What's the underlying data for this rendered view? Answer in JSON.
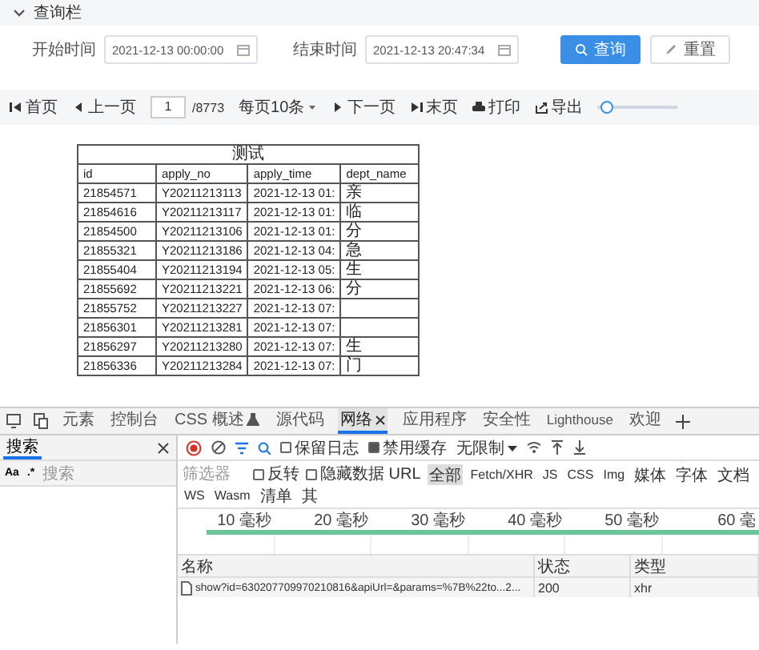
{
  "query_panel": {
    "title": "查询栏",
    "expanded": true,
    "fields": [
      {
        "label": "开始时间",
        "value": "2021-12-13 00:00:00"
      },
      {
        "label": "结束时间",
        "value": "2021-12-13 20:47:34"
      }
    ],
    "buttons": [
      {
        "label": "查询",
        "kind": "primary"
      },
      {
        "label": "重置",
        "kind": "default"
      }
    ]
  },
  "pager": {
    "first": "首页",
    "prev": "上一页",
    "page": "1",
    "total": "/8773",
    "page_size": "每页10条",
    "next": "下一页",
    "last": "末页",
    "print": "打印",
    "export": "导出",
    "zoom": {
      "level": 0.05
    }
  },
  "report": {
    "title": "测试",
    "columns": [
      "id",
      "apply_no",
      "apply_time",
      "dept_name"
    ],
    "rows": [
      [
        "21854571",
        "Y20211213113",
        "2021-12-13 01:",
        "亲"
      ],
      [
        "21854616",
        "Y20211213117",
        "2021-12-13 01:",
        "临"
      ],
      [
        "21854500",
        "Y20211213106",
        "2021-12-13 01:",
        "分"
      ],
      [
        "21855321",
        "Y20211213186",
        "2021-12-13 04:",
        "急"
      ],
      [
        "21855404",
        "Y20211213194",
        "2021-12-13 05:",
        "生"
      ],
      [
        "21855692",
        "Y20211213221",
        "2021-12-13 06:",
        "分"
      ],
      [
        "21855752",
        "Y20211213227",
        "2021-12-13 07:"
      ],
      [
        "21856301",
        "Y20211213281",
        "2021-12-13 07:"
      ],
      [
        "21856297",
        "Y20211213280",
        "2021-12-13 07:",
        "生"
      ],
      [
        "21856336",
        "Y20211213284",
        "2021-12-13 07:",
        "门"
      ]
    ]
  },
  "devtools": {
    "tabs": [
      {
        "label": "元素",
        "selected": false
      },
      {
        "label": "控制台",
        "selected": false
      },
      {
        "label": "CSS 概述",
        "selected": false,
        "experimental": true
      },
      {
        "label": "源代码",
        "selected": false
      },
      {
        "label": "网络",
        "selected": true,
        "closable": true
      },
      {
        "label": "应用程序",
        "selected": false
      },
      {
        "label": "安全性",
        "selected": false
      },
      {
        "label": "Lighthouse",
        "selected": false
      },
      {
        "label": "欢迎",
        "selected": false
      }
    ],
    "search_panel": {
      "tab": "搜索",
      "case": "Aa",
      "regex": ".*",
      "placeholder": "搜索"
    },
    "toolbar": {
      "recording": true,
      "preserve_log": {
        "label": "保留日志",
        "checked": false
      },
      "disable_cache": {
        "label": "禁用缓存",
        "checked": true
      },
      "throttle": "无限制"
    },
    "filter": {
      "placeholder": "筛选器",
      "invert": {
        "label": "反转",
        "checked": false
      },
      "hide_data_urls": {
        "label": "隐藏数据 URL",
        "checked": false
      },
      "types": [
        {
          "label": "全部",
          "selected": true
        },
        {
          "label": "Fetch/XHR",
          "selected": false
        },
        {
          "label": "JS",
          "selected": false
        },
        {
          "label": "CSS",
          "selected": false
        },
        {
          "label": "Img",
          "selected": false
        },
        {
          "label": "媒体",
          "selected": false
        },
        {
          "label": "字体",
          "selected": false
        },
        {
          "label": "文档",
          "selected": false
        },
        {
          "label": "WS",
          "selected": false
        },
        {
          "label": "Wasm",
          "selected": false
        },
        {
          "label": "清单",
          "selected": false
        },
        {
          "label": "其",
          "selected": false
        }
      ]
    },
    "timeline": {
      "ticks": [
        "10 毫秒",
        "20 毫秒",
        "30 毫秒",
        "40 毫秒",
        "50 毫秒",
        "60 毫"
      ]
    },
    "requests": {
      "columns": [
        "名称",
        "状态",
        "类型"
      ],
      "rows": [
        {
          "name": "show?id=630207709970210816&apiUrl=&params=%7B%22to...2...",
          "status": "200",
          "type": "xhr"
        }
      ]
    }
  }
}
